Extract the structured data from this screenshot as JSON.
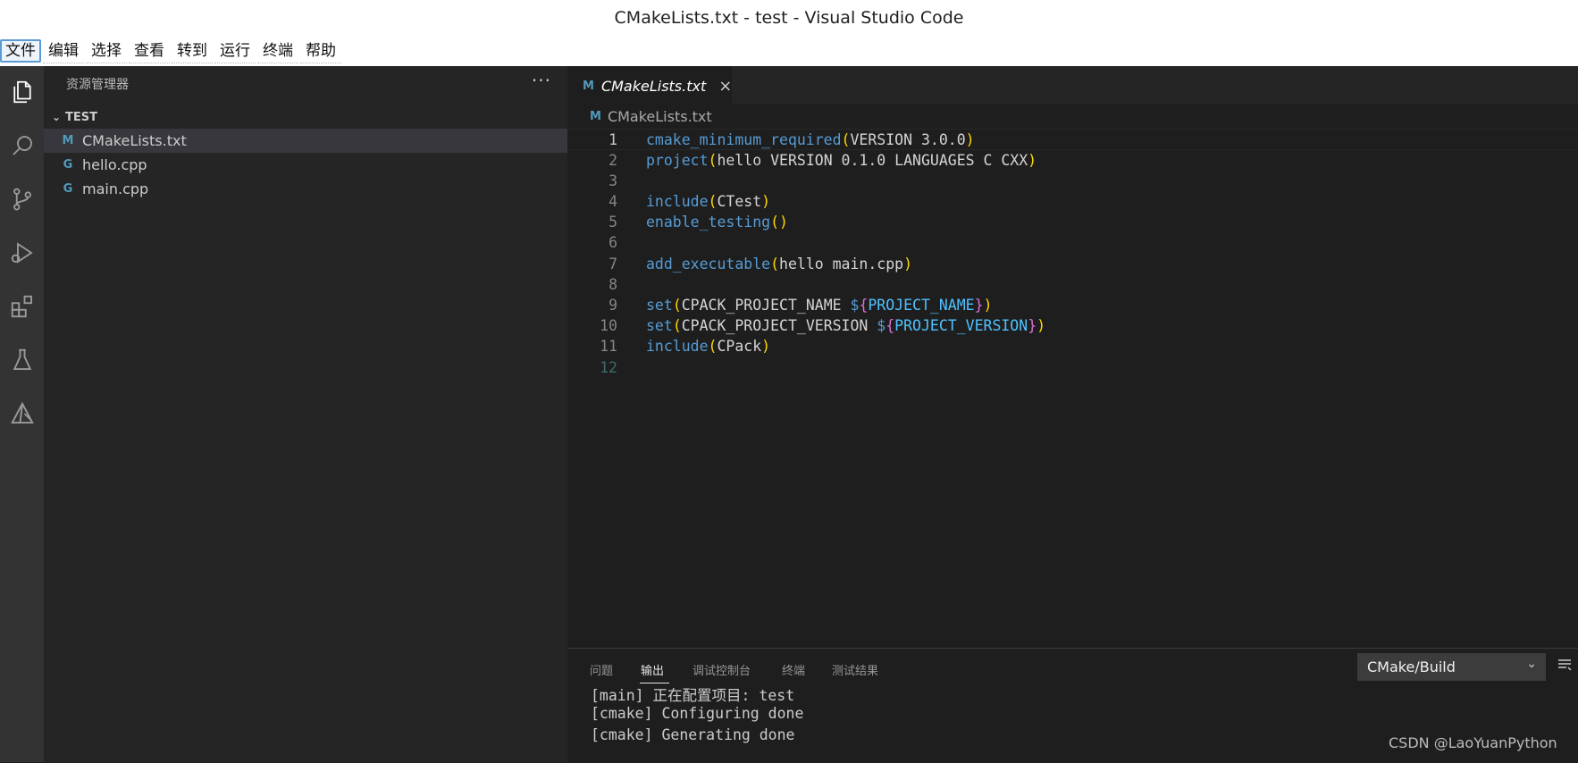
{
  "window": {
    "title": "CMakeLists.txt - test - Visual Studio Code"
  },
  "menu": [
    "文件",
    "编辑",
    "选择",
    "查看",
    "转到",
    "运行",
    "终端",
    "帮助"
  ],
  "activity_bar": [
    "files-icon",
    "search-icon",
    "source-control-icon",
    "run-debug-icon",
    "extensions-icon",
    "testing-icon",
    "cmake-icon"
  ],
  "sidebar": {
    "title": "资源管理器",
    "more": "···",
    "section": "TEST",
    "files": [
      {
        "icon": "M",
        "name": "CMakeLists.txt",
        "selected": true
      },
      {
        "icon": "G",
        "name": "hello.cpp",
        "selected": false
      },
      {
        "icon": "G",
        "name": "main.cpp",
        "selected": false
      }
    ]
  },
  "editor": {
    "tab": {
      "icon": "M",
      "name": "CMakeLists.txt",
      "close": "×"
    },
    "breadcrumb": {
      "icon": "M",
      "name": "CMakeLists.txt"
    },
    "line_numbers": [
      "1",
      "2",
      "3",
      "4",
      "5",
      "6",
      "7",
      "8",
      "9",
      "10",
      "11",
      "12"
    ],
    "code": {
      "l1": {
        "fn": "cmake_minimum_required",
        "open": "(",
        "args": "VERSION 3.0.0",
        "close": ")"
      },
      "l2": {
        "fn": "project",
        "open": "(",
        "args": "hello VERSION 0.1.0 LANGUAGES C CXX",
        "close": ")"
      },
      "l4": {
        "fn": "include",
        "open": "(",
        "args": "CTest",
        "close": ")"
      },
      "l5": {
        "fn": "enable_testing",
        "open": "(",
        "close": ")"
      },
      "l7": {
        "fn": "add_executable",
        "open": "(",
        "args": "hello main.cpp",
        "close": ")"
      },
      "l9": {
        "fn": "set",
        "open": "(",
        "args": "CPACK_PROJECT_NAME ",
        "dollar": "$",
        "b_open": "{",
        "var": "PROJECT_NAME",
        "b_close": "}",
        "close": ")"
      },
      "l10": {
        "fn": "set",
        "open": "(",
        "args": "CPACK_PROJECT_VERSION ",
        "dollar": "$",
        "b_open": "{",
        "var": "PROJECT_VERSION",
        "b_close": "}",
        "close": ")"
      },
      "l11": {
        "fn": "include",
        "open": "(",
        "args": "CPack",
        "close": ")"
      }
    }
  },
  "panel": {
    "tabs": [
      "问题",
      "输出",
      "调试控制台",
      "终端",
      "测试结果"
    ],
    "active_tab": "输出",
    "dropdown": "CMake/Build",
    "output": [
      "[main] 正在配置项目: test",
      "[cmake] Configuring done",
      "[cmake] Generating done"
    ]
  },
  "watermark": "CSDN @LaoYuanPython",
  "colors": {
    "accent": "#519aba",
    "function": "#569cd6",
    "bracket1": "#ffd700",
    "bracket2": "#da70d6",
    "variable": "#4fc1ff"
  }
}
